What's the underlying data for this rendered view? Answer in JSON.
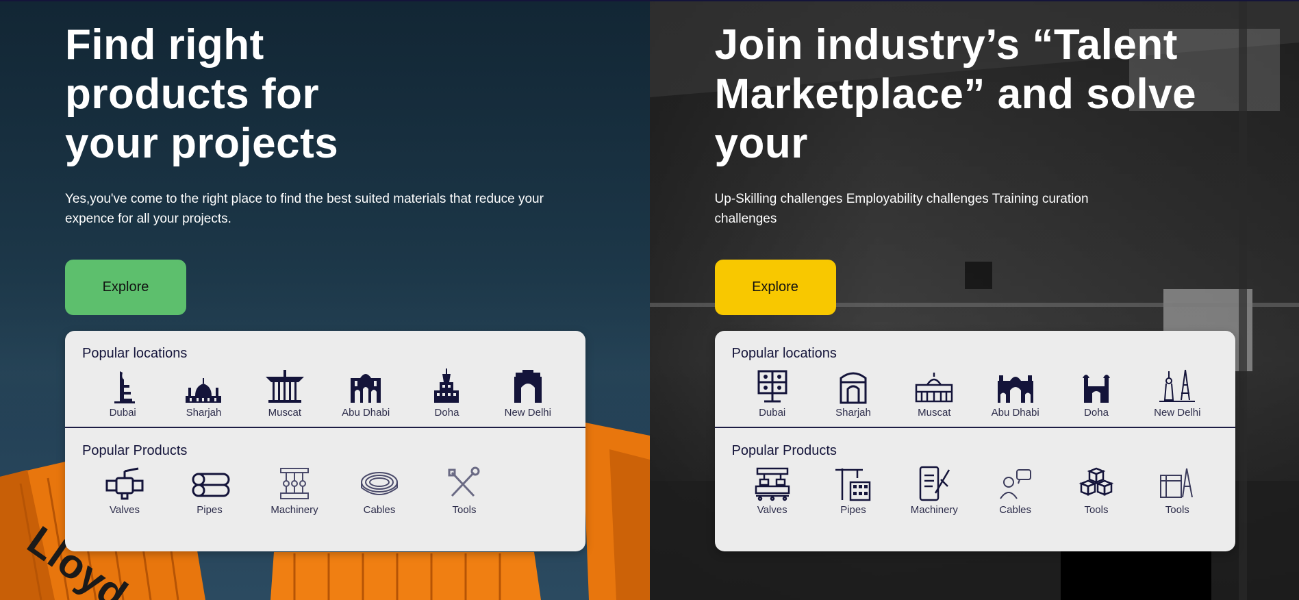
{
  "left": {
    "title": "Find right products for your projects",
    "description": "Yes,you've come to the right place to find the best suited materials that reduce your expence for all your projects.",
    "button_label": "Explore",
    "locations_title": "Popular locations",
    "locations": [
      {
        "label": "Dubai",
        "icon": "burj-al-arab-icon"
      },
      {
        "label": "Sharjah",
        "icon": "mosque-icon"
      },
      {
        "label": "Muscat",
        "icon": "pavilion-icon"
      },
      {
        "label": "Abu Dhabi",
        "icon": "palace-icon"
      },
      {
        "label": "Doha",
        "icon": "tower-icon"
      },
      {
        "label": "New Delhi",
        "icon": "india-gate-icon"
      }
    ],
    "products_title": "Popular Products",
    "products": [
      {
        "label": "Valves",
        "icon": "valve-icon"
      },
      {
        "label": "Pipes",
        "icon": "pipes-icon"
      },
      {
        "label": "Machinery",
        "icon": "machinery-icon"
      },
      {
        "label": "Cables",
        "icon": "cable-icon"
      },
      {
        "label": "Tools",
        "icon": "tools-icon"
      }
    ]
  },
  "right": {
    "title": "Join industry’s “Talent Marketplace” and solve your",
    "description": "Up-Skilling challenges Employability challenges Training curation challenges",
    "button_label": "Explore",
    "locations_title": "Popular locations",
    "locations": [
      {
        "label": "Dubai",
        "icon": "presentation-board-icon"
      },
      {
        "label": "Sharjah",
        "icon": "gate-icon"
      },
      {
        "label": "Muscat",
        "icon": "palace-icon"
      },
      {
        "label": "Abu Dhabi",
        "icon": "gateway-icon"
      },
      {
        "label": "Doha",
        "icon": "minaret-icon"
      },
      {
        "label": "New Delhi",
        "icon": "liberty-eiffel-icon"
      }
    ],
    "products_title": "Popular Products",
    "products": [
      {
        "label": "Valves",
        "icon": "conveyor-icon"
      },
      {
        "label": "Pipes",
        "icon": "crane-building-icon"
      },
      {
        "label": "Machinery",
        "icon": "tablet-design-icon"
      },
      {
        "label": "Cables",
        "icon": "chat-user-icon"
      },
      {
        "label": "Tools",
        "icon": "boxes-icon"
      },
      {
        "label": "Tools",
        "icon": "blueprint-icon"
      }
    ]
  },
  "colors": {
    "green_button": "#5dbf6d",
    "yellow_button": "#f8c800",
    "icon_navy": "#14143a",
    "card_bg": "#ececec"
  }
}
